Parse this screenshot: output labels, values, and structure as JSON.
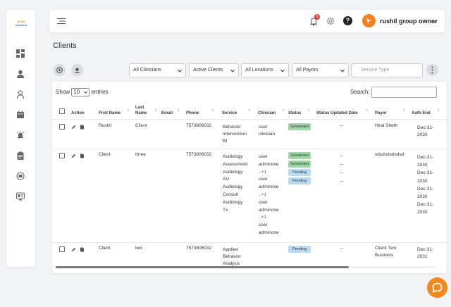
{
  "logo": {
    "line1": "Buildi",
    "line2": "Connect"
  },
  "header": {
    "notification_count": "2",
    "help_symbol": "?",
    "user_name": "rushil group owner"
  },
  "page": {
    "title": "Clients"
  },
  "filters": {
    "clinicians": "All Clinicians",
    "status": "Active Clients",
    "locations": "All Locations",
    "payors": "All Payors",
    "service_type_placeholder": "Service Type"
  },
  "table_controls": {
    "show": "Show",
    "entries_value": "10",
    "entries": "entries",
    "search_label": "Search:"
  },
  "columns": {
    "action": "Action",
    "first_name": "First Name",
    "last_name_1": "Last",
    "last_name_2": "Name",
    "email": "Email",
    "phone": "Phone",
    "service": "Service",
    "clinician": "Clinician",
    "status": "Status",
    "status_updated": "Status Updated Date",
    "payor": "Payor",
    "auth_end": "Auth End"
  },
  "rows": [
    {
      "first_name": "Rushil",
      "last_name": "Client",
      "phone": "7573806032",
      "services": [
        "Behavior",
        "Intervention",
        "BI"
      ],
      "clinicians": [
        "user",
        "clinician"
      ],
      "statuses": [
        "Scheduled"
      ],
      "updated": [
        "--"
      ],
      "payor": "Hiral Sheth",
      "auth_end": [
        "Dec-31-",
        "2030"
      ]
    },
    {
      "first_name": "Client",
      "last_name": "three",
      "phone": "7573806032",
      "services": [
        "Audiology",
        "Assessment",
        "Audiology",
        "AU",
        "Audiology",
        "Consult",
        "Audiology",
        "Tx"
      ],
      "clinicians": [
        "user",
        "adminone",
        "..+1",
        "user",
        "adminone",
        "..+1",
        "user",
        "adminone",
        "..+1",
        "user",
        "adminone"
      ],
      "statuses": [
        "Scheduled",
        "Scheduled",
        "Pending",
        "Pending"
      ],
      "updated": [
        "--",
        "--",
        "--",
        "--"
      ],
      "payor": "sdsdsdsdsdsd",
      "auth_end": [
        "Dec-31-",
        "2030",
        "Dec-31-",
        "2030",
        "Dec-31-",
        "2030",
        "Dec-31-",
        "2030"
      ]
    },
    {
      "first_name": "Client",
      "last_name": "two",
      "phone": "7573806032",
      "services": [
        "Applied",
        "Behavior",
        "Analysis"
      ],
      "statuses": [
        "Pending"
      ],
      "updated": [
        "--"
      ],
      "payor_lines": [
        "Client Two",
        "Business"
      ],
      "auth_end": [
        "Dec-31-",
        "2031"
      ]
    }
  ],
  "colors": {
    "accent": "#f08a1c",
    "scheduled": "#9ed8a6",
    "pending": "#b7dcf2",
    "badge": "#e53935"
  }
}
